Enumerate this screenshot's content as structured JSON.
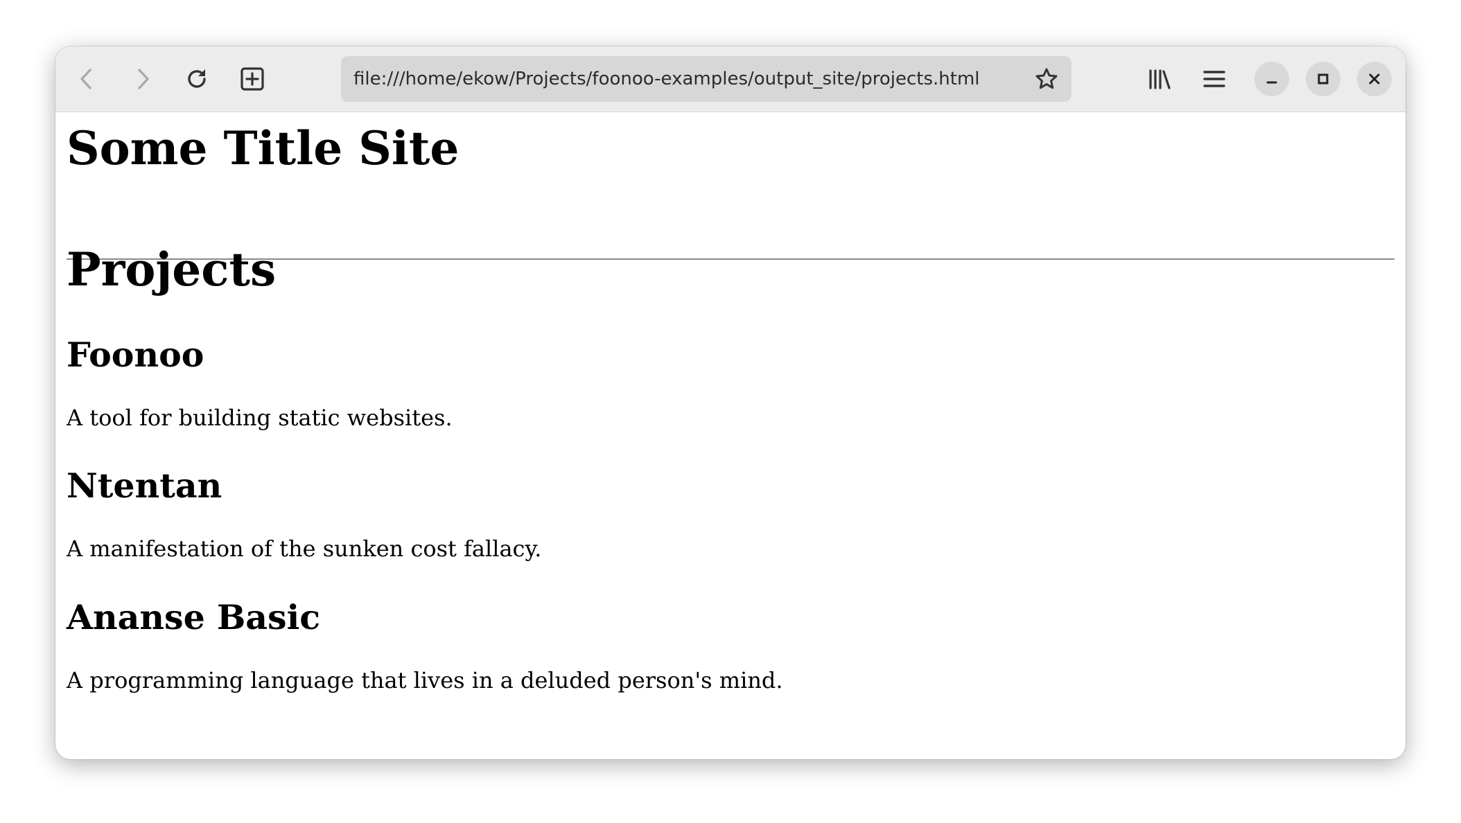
{
  "browser": {
    "url": "file:///home/ekow/Projects/foonoo-examples/output_site/projects.html",
    "icons": {
      "back": "chevron-left-icon",
      "forward": "chevron-right-icon",
      "reload": "reload-icon",
      "new_tab": "plus-square-icon",
      "bookmark": "star-icon",
      "library": "library-icon",
      "menu": "hamburger-menu-icon",
      "minimize": "minimize-icon",
      "maximize": "maximize-icon",
      "close": "close-icon"
    },
    "colors": {
      "toolbar_bg": "#ececec",
      "urlbar_bg": "#d7d7d7",
      "disabled_icon": "#a9a9a9",
      "icon": "#333333"
    }
  },
  "page": {
    "site_title": "Some Title Site",
    "heading": "Projects",
    "projects": [
      {
        "name": "Foonoo",
        "description": "A tool for building static websites."
      },
      {
        "name": "Ntentan",
        "description": "A manifestation of the sunken cost fallacy."
      },
      {
        "name": "Ananse Basic",
        "description": "A programming language that lives in a deluded person's mind."
      }
    ]
  }
}
